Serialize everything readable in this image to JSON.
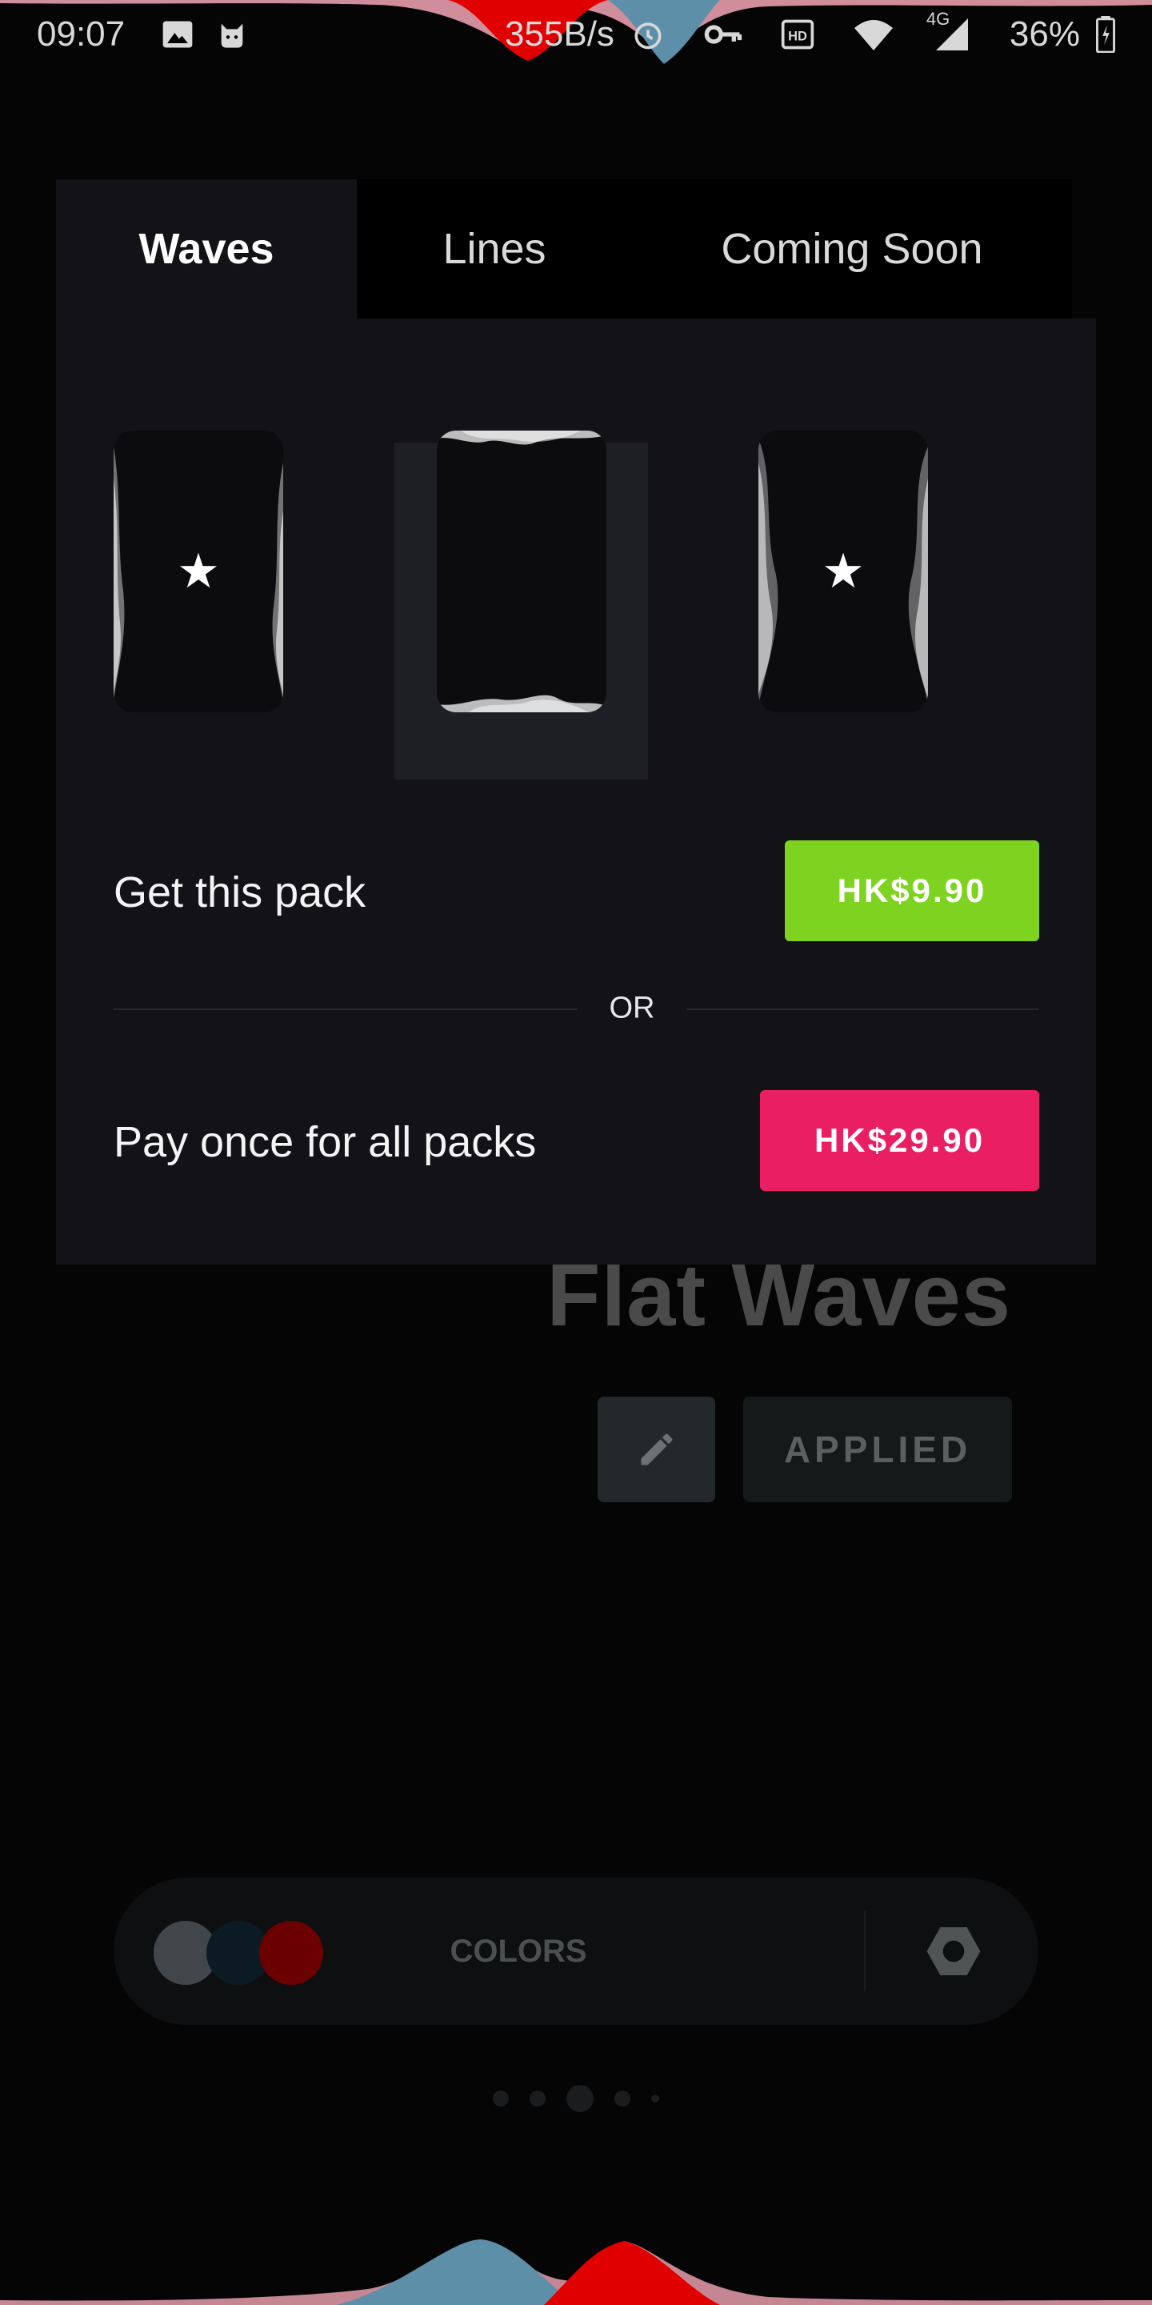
{
  "status_bar": {
    "time": "09:07",
    "net_speed": "355B/s",
    "network_type": "4G",
    "battery": "36%",
    "icons": [
      "image-icon",
      "cat-notification-icon",
      "alarm-icon",
      "vpn-key-icon",
      "hd-icon",
      "wifi-icon",
      "signal-icon",
      "battery-icon"
    ]
  },
  "dialog": {
    "tabs": [
      {
        "label": "Waves",
        "active": true
      },
      {
        "label": "Lines",
        "active": false
      },
      {
        "label": "Coming Soon",
        "active": false
      }
    ],
    "thumbnails": [
      {
        "style": "side-waves",
        "premium": true,
        "star": "★"
      },
      {
        "style": "top-bottom-waves",
        "premium": false,
        "selected": true
      },
      {
        "style": "side-waves-heavy",
        "premium": true,
        "star": "★"
      }
    ],
    "get_pack": {
      "label": "Get this pack",
      "price": "HK$9.90",
      "color": "#7ed321"
    },
    "separator": "OR",
    "all_packs": {
      "label": "Pay once for all packs",
      "price": "HK$29.90",
      "color": "#e91e63"
    }
  },
  "background": {
    "title": "Flat Waves",
    "edit_icon": "pencil-icon",
    "applied_label": "APPLIED",
    "colors": {
      "label": "COLORS",
      "swatches": [
        "#404649",
        "#0b1a23",
        "#6b0000"
      ],
      "settings_icon": "hexagon-nut-icon"
    },
    "page_indicator": {
      "count": 5,
      "active_index": 2
    }
  },
  "accent_colors": {
    "wave_red": "#e00000",
    "wave_pink": "#f4a6b6",
    "wave_blue": "#5d8fa8"
  }
}
